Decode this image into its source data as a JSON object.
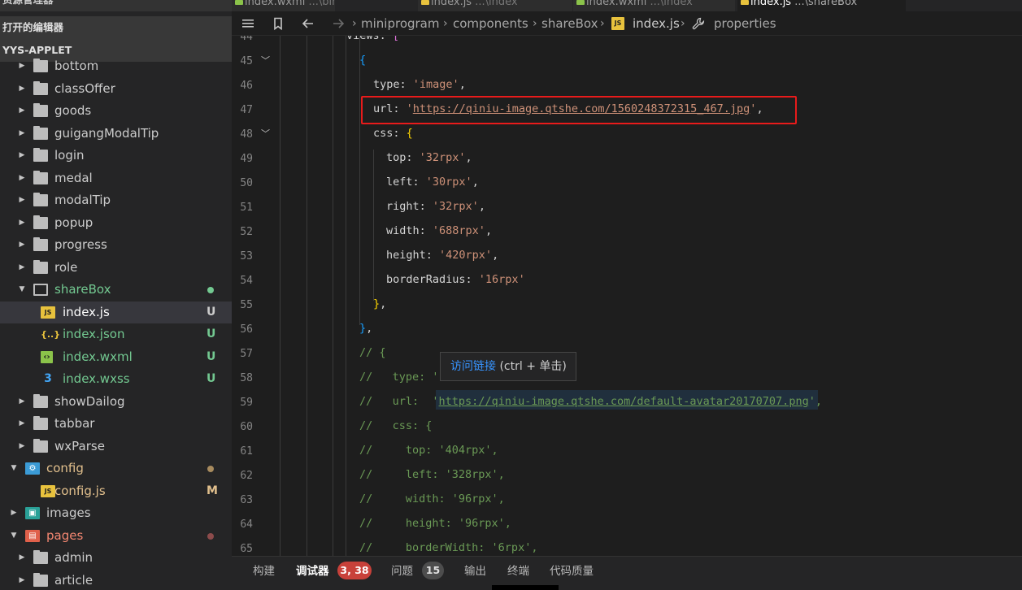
{
  "sidebar": {
    "title": "资源管理器",
    "open_editors": "打开的编辑器",
    "project": "YYS-APPLET",
    "items": [
      {
        "label": "bottom",
        "type": "folder",
        "depth": 1,
        "expanded": false
      },
      {
        "label": "classOffer",
        "type": "folder",
        "depth": 1,
        "expanded": false
      },
      {
        "label": "goods",
        "type": "folder",
        "depth": 1,
        "expanded": false
      },
      {
        "label": "guigangModalTip",
        "type": "folder",
        "depth": 1,
        "expanded": false
      },
      {
        "label": "login",
        "type": "folder",
        "depth": 1,
        "expanded": false
      },
      {
        "label": "medal",
        "type": "folder",
        "depth": 1,
        "expanded": false
      },
      {
        "label": "modalTip",
        "type": "folder",
        "depth": 1,
        "expanded": false
      },
      {
        "label": "popup",
        "type": "folder",
        "depth": 1,
        "expanded": false
      },
      {
        "label": "progress",
        "type": "folder",
        "depth": 1,
        "expanded": false
      },
      {
        "label": "role",
        "type": "folder",
        "depth": 1,
        "expanded": false
      },
      {
        "label": "shareBox",
        "type": "folder",
        "depth": 1,
        "expanded": true,
        "color": "#73c991",
        "dot": "#73c991"
      },
      {
        "label": "index.js",
        "type": "js",
        "depth": 2,
        "selected": true,
        "status": "U",
        "color": "#ffffff",
        "status_color": "#cccccc"
      },
      {
        "label": "index.json",
        "type": "json",
        "depth": 2,
        "status": "U",
        "color": "#73c991",
        "status_color": "#73c991"
      },
      {
        "label": "index.wxml",
        "type": "wxml",
        "depth": 2,
        "status": "U",
        "color": "#73c991",
        "status_color": "#73c991"
      },
      {
        "label": "index.wxss",
        "type": "wxss",
        "depth": 2,
        "status": "U",
        "color": "#73c991",
        "status_color": "#73c991"
      },
      {
        "label": "showDailog",
        "type": "folder",
        "depth": 1,
        "expanded": false
      },
      {
        "label": "tabbar",
        "type": "folder",
        "depth": 1,
        "expanded": false
      },
      {
        "label": "wxParse",
        "type": "folder",
        "depth": 1,
        "expanded": false
      },
      {
        "label": "config",
        "type": "config-folder",
        "depth": 0,
        "expanded": true,
        "color": "#e2c08d",
        "dot": "#a88b5e"
      },
      {
        "label": "config.js",
        "type": "js",
        "depth": 1,
        "status": "M",
        "color": "#e2c08d",
        "status_color": "#e2c08d"
      },
      {
        "label": "images",
        "type": "images-folder",
        "depth": 0,
        "expanded": false
      },
      {
        "label": "pages",
        "type": "pages-folder",
        "depth": 0,
        "expanded": true,
        "color": "#f48771",
        "dot": "#8c4b4b"
      },
      {
        "label": "admin",
        "type": "folder",
        "depth": 1,
        "expanded": false
      },
      {
        "label": "article",
        "type": "folder",
        "depth": 1,
        "expanded": false
      }
    ]
  },
  "tabs": [
    {
      "label": "index.wxml",
      "dim": "...\\bin_test"
    },
    {
      "label": "index.js",
      "dim": "...\\index"
    },
    {
      "label": "index.wxml",
      "dim": "...\\index"
    },
    {
      "label": "index.js",
      "dim": "...\\shareBox",
      "active": true
    }
  ],
  "breadcrumb": [
    "miniprogram",
    "components",
    "shareBox",
    "index.js",
    "properties"
  ],
  "code": {
    "first_line": 45,
    "lines": [
      {
        "n": 44,
        "fold": false
      },
      {
        "n": 45,
        "fold": true
      },
      {
        "n": 46,
        "fold": false
      },
      {
        "n": 47,
        "fold": false
      },
      {
        "n": 48,
        "fold": true
      },
      {
        "n": 49
      },
      {
        "n": 50
      },
      {
        "n": 51
      },
      {
        "n": 52
      },
      {
        "n": 53
      },
      {
        "n": 54
      },
      {
        "n": 55
      },
      {
        "n": 56
      },
      {
        "n": 57
      },
      {
        "n": 58
      },
      {
        "n": 59
      },
      {
        "n": 60
      },
      {
        "n": 61
      },
      {
        "n": 62
      },
      {
        "n": 63
      },
      {
        "n": 64
      },
      {
        "n": 65
      }
    ],
    "views_key": "views",
    "type_val": "'image'",
    "url_val": "https://qiniu-image.qtshe.com/1560248372315_467.jpg",
    "css_vals": {
      "top": "'32rpx'",
      "left": "'30rpx'",
      "right": "'32rpx'",
      "width": "'688rpx'",
      "height": "'420rpx'",
      "borderRadius": "'16rpx'"
    },
    "comment_url": "https://qiniu-image.qtshe.com/default-avatar20170707.png",
    "comment_css": {
      "top": "'404rpx'",
      "left": "'328rpx'",
      "width": "'96rpx'",
      "height": "'96rpx'",
      "borderWidth": "'6rpx'"
    }
  },
  "hover": {
    "link_text": "访问链接",
    "hint": "(ctrl + 单击)"
  },
  "panel": {
    "tabs": [
      "构建",
      "调试器",
      "问题",
      "输出",
      "终端",
      "代码质量"
    ],
    "debugger_badge": "3, 38",
    "problems_badge": "15"
  },
  "colors": {
    "highlight_box": "#e81b1b",
    "badge_red": "#c8413a"
  }
}
